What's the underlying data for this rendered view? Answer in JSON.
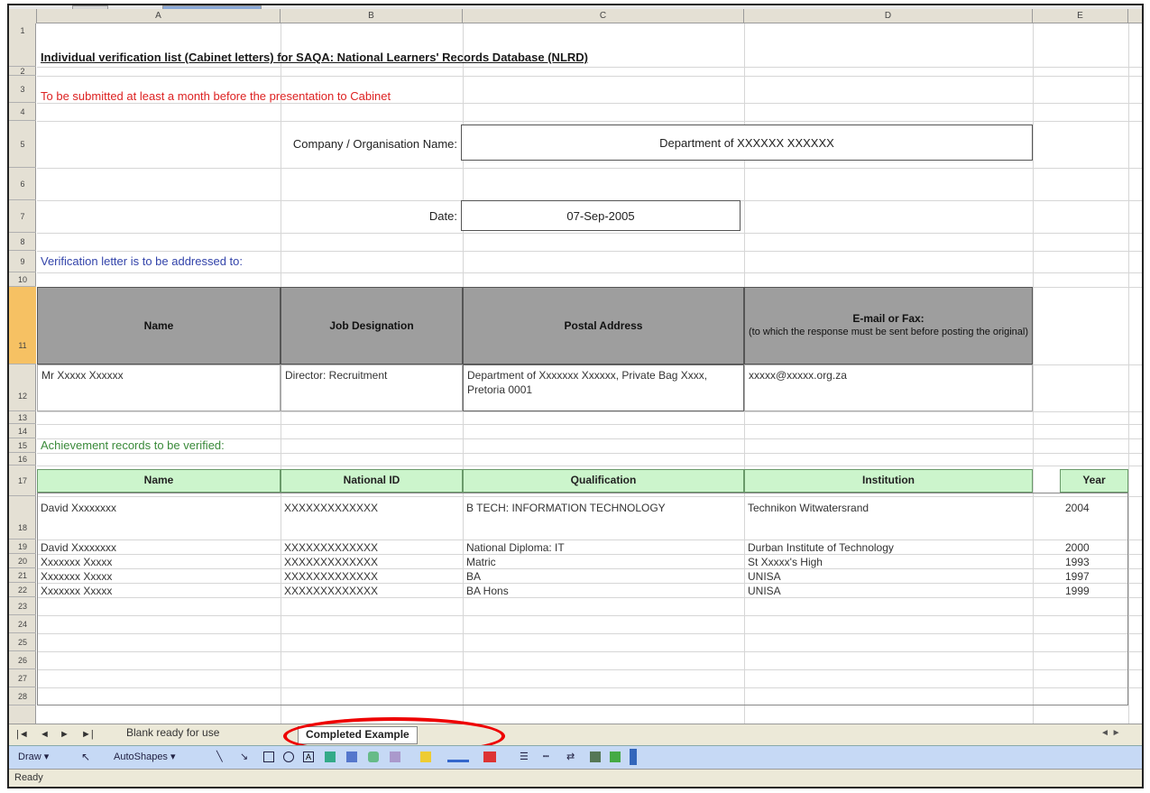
{
  "columns": [
    "A",
    "B",
    "C",
    "D",
    "E"
  ],
  "rows": [
    "1",
    "2",
    "3",
    "4",
    "5",
    "6",
    "7",
    "8",
    "9",
    "10",
    "11",
    "12",
    "13",
    "14",
    "15",
    "16",
    "17",
    "18",
    "19",
    "20",
    "21",
    "22",
    "23",
    "24",
    "25",
    "26",
    "27",
    "28"
  ],
  "title": "Individual verification list (Cabinet letters) for SAQA: National Learners' Records Database (NLRD)",
  "instruction": "To be submitted at least a month before the presentation to Cabinet",
  "company_label": "Company / Organisation Name:",
  "company_value": "Department of XXXXXX XXXXXX",
  "date_label": "Date:",
  "date_value": "07-Sep-2005",
  "address_heading": "Verification letter is to be addressed to:",
  "address_table": {
    "headers": [
      "Name",
      "Job Designation",
      "Postal Address",
      "E-mail or Fax:"
    ],
    "email_note": "(to which the response must be sent before posting the original)",
    "row": [
      "Mr Xxxxx Xxxxxx",
      "Director: Recruitment",
      "Department of Xxxxxxx Xxxxxx, Private Bag Xxxx, Pretoria 0001",
      "xxxxx@xxxxx.org.za"
    ]
  },
  "records_heading": "Achievement records to be verified:",
  "records_table": {
    "headers": [
      "Name",
      "National ID",
      "Qualification",
      "Institution",
      "Year"
    ],
    "rows": [
      [
        "David Xxxxxxxx",
        "XXXXXXXXXXXXX",
        "B TECH: INFORMATION TECHNOLOGY",
        "Technikon Witwatersrand",
        "2004"
      ],
      [
        "David Xxxxxxxx",
        "XXXXXXXXXXXXX",
        "National Diploma: IT",
        "Durban Institute of Technology",
        "2000"
      ],
      [
        "Xxxxxxx Xxxxx",
        "XXXXXXXXXXXXX",
        "Matric",
        "St Xxxxx's High",
        "1993"
      ],
      [
        "Xxxxxxx Xxxxx",
        "XXXXXXXXXXXXX",
        "BA",
        "UNISA",
        "1997"
      ],
      [
        "Xxxxxxx Xxxxx",
        "XXXXXXXXXXXXX",
        "BA Hons",
        "UNISA",
        "1999"
      ]
    ]
  },
  "sheet_tabs": [
    "Blank ready for use",
    "Completed Example"
  ],
  "tab_nav": [
    "|◄",
    "◄",
    "►",
    "►|"
  ],
  "drawing_toolbar": {
    "draw": "Draw ▾",
    "autoshapes": "AutoShapes ▾"
  },
  "status_text": "Ready",
  "colors": {
    "accent_circle": "#e00000",
    "grey_header": "#9e9e9e",
    "green_header": "#ccf5cc",
    "selected_row": "#f6c163"
  }
}
